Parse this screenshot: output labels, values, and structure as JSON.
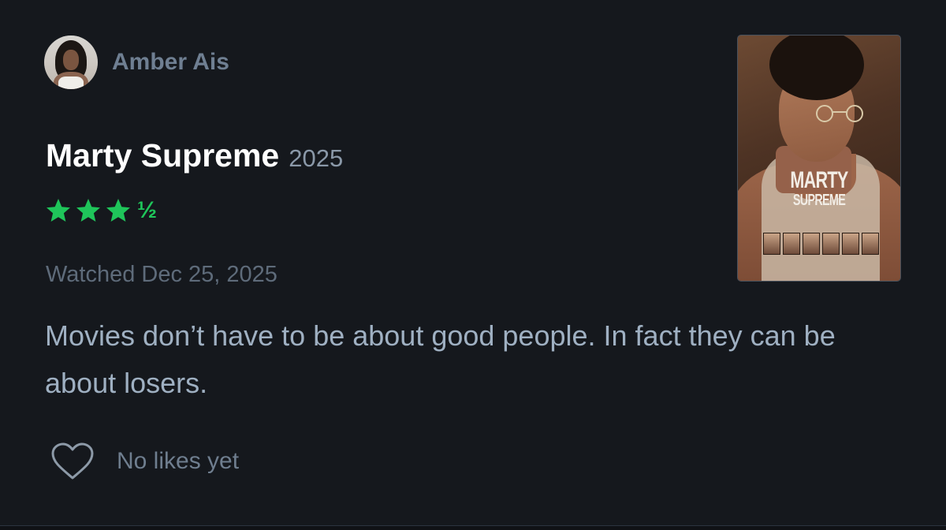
{
  "review": {
    "author": {
      "name": "Amber Ais"
    },
    "film": {
      "title": "Marty Supreme",
      "year": "2025"
    },
    "rating": {
      "stars": 3.5,
      "max": 5,
      "half_glyph": "½",
      "color": "#1fc55a"
    },
    "watched": "Watched Dec 25, 2025",
    "text": "Movies don’t have to be about good people. In fact they can be about losers.",
    "likes": {
      "icon": "heart-outline-icon",
      "text": "No likes yet"
    },
    "poster": {
      "title_line1": "MARTY",
      "title_line2": "SUPREME"
    }
  }
}
